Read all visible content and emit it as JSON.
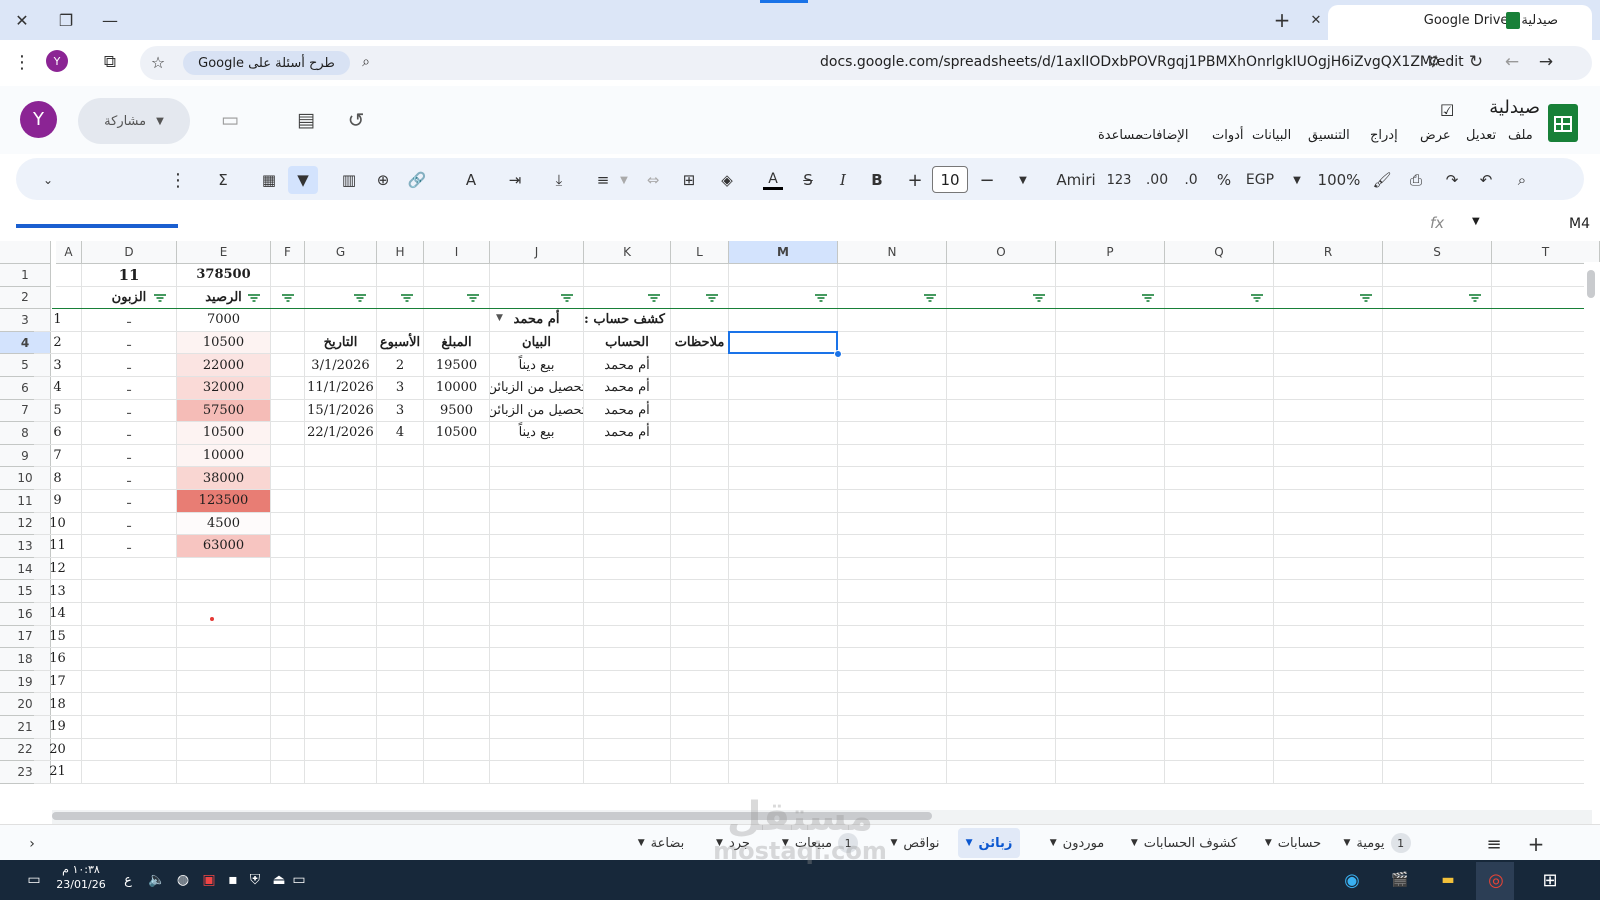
{
  "browser": {
    "tab_title": "صيدلية - Google Drive",
    "url": "docs.google.com/spreadsheets/d/1axlIODxbPOVRgqj1PBMXhOnrlgkIUOgjH6iZvgQX1ZM/edit",
    "search_chip": "طرح أسئلة على Google",
    "profile_letter": "Y"
  },
  "doc": {
    "title": "صيدلية",
    "menus": [
      "ملف",
      "تعديل",
      "عرض",
      "إدراج",
      "التنسيق",
      "البيانات",
      "أدوات",
      "الإضافات",
      "مساعدة"
    ],
    "share_label": "مشاركة",
    "user_letter": "Y"
  },
  "toolbar": {
    "zoom": "100%",
    "currency": "EGP",
    "percent": "%",
    "decimal_dec": ".0",
    "decimal_inc": ".00",
    "number_format": "123",
    "font": "Amiri",
    "font_size": "10",
    "bold": "B",
    "italic": "I"
  },
  "formula_bar": {
    "name_box": "M4",
    "fx": "fx"
  },
  "grid": {
    "columns": [
      "T",
      "S",
      "R",
      "Q",
      "P",
      "O",
      "N",
      "M",
      "L",
      "K",
      "J",
      "I",
      "H",
      "G",
      "F",
      "E",
      "D",
      "A"
    ],
    "rows": [
      "1",
      "2",
      "3",
      "4",
      "5",
      "6",
      "7",
      "8",
      "9",
      "10",
      "11",
      "12",
      "13",
      "14",
      "15",
      "16",
      "17",
      "18",
      "19",
      "20",
      "21",
      "22",
      "23"
    ],
    "selected_cell": "M4",
    "e_header_total": "378500",
    "d_header_count": "11",
    "e_col_title": "الرصيد",
    "d_col_title": "الزبون",
    "balances": [
      "7000",
      "10500",
      "22000",
      "32000",
      "57500",
      "10500",
      "10000",
      "38000",
      "123500",
      "4500",
      "63000"
    ],
    "balance_colors": [
      "#ffffff",
      "#fdf3f2",
      "#fbe4e2",
      "#fadad7",
      "#f5bcb7",
      "#fdf3f2",
      "#fdf4f3",
      "#f9d6d2",
      "#e87d74",
      "#fefbfb",
      "#f7c5c1"
    ],
    "customers": [
      "ـ",
      "ـ",
      "ـ",
      "ـ",
      "ـ",
      "ـ",
      "ـ",
      "ـ",
      "ـ",
      "ـ",
      "ـ"
    ],
    "row_numbers": [
      "1",
      "2",
      "3",
      "4",
      "5",
      "6",
      "7",
      "8",
      "9",
      "10",
      "11",
      "12",
      "13",
      "14",
      "15",
      "16",
      "17",
      "18",
      "19",
      "20",
      "21"
    ],
    "statement_label": "كشف حساب :",
    "statement_customer": "أم محمد",
    "headers": {
      "account": "الحساب",
      "description": "البيان",
      "amount": "المبلغ",
      "week": "الأسبوع",
      "date": "التاريخ",
      "notes": "ملاحظات"
    },
    "statement_rows": [
      {
        "account": "أم محمد",
        "description": "بيع ديناً",
        "amount": "19500",
        "week": "2",
        "date": "3/1/2026"
      },
      {
        "account": "أم محمد",
        "description": "تحصيل من الزبائن",
        "amount": "10000",
        "week": "3",
        "date": "11/1/2026"
      },
      {
        "account": "أم محمد",
        "description": "تحصيل من الزبائن",
        "amount": "9500",
        "week": "3",
        "date": "15/1/2026"
      },
      {
        "account": "أم محمد",
        "description": "بيع ديناً",
        "amount": "10500",
        "week": "4",
        "date": "22/1/2026"
      }
    ]
  },
  "sheets": {
    "tabs": [
      {
        "label": "يومية",
        "badge": "1",
        "active": false
      },
      {
        "label": "حسابات",
        "badge": "",
        "active": false
      },
      {
        "label": "كشوف الحسابات",
        "badge": "",
        "active": false
      },
      {
        "label": "موردون",
        "badge": "",
        "active": false
      },
      {
        "label": "زبائن",
        "badge": "",
        "active": true
      },
      {
        "label": "نواقص",
        "badge": "",
        "active": false
      },
      {
        "label": "مبيعات",
        "badge": "1",
        "active": false
      },
      {
        "label": "جرد",
        "badge": "",
        "active": false
      },
      {
        "label": "بضاعة",
        "badge": "",
        "active": false
      }
    ]
  },
  "taskbar": {
    "time": "١٠:٣٨ م",
    "date": "23/01/26",
    "lang": "ع"
  },
  "watermark": {
    "line1": "مستقل",
    "line2": "mostaqi.com"
  },
  "colors": {
    "accent": "#1a73e8",
    "sheets_green": "#188038",
    "filter_green": "#188038"
  }
}
